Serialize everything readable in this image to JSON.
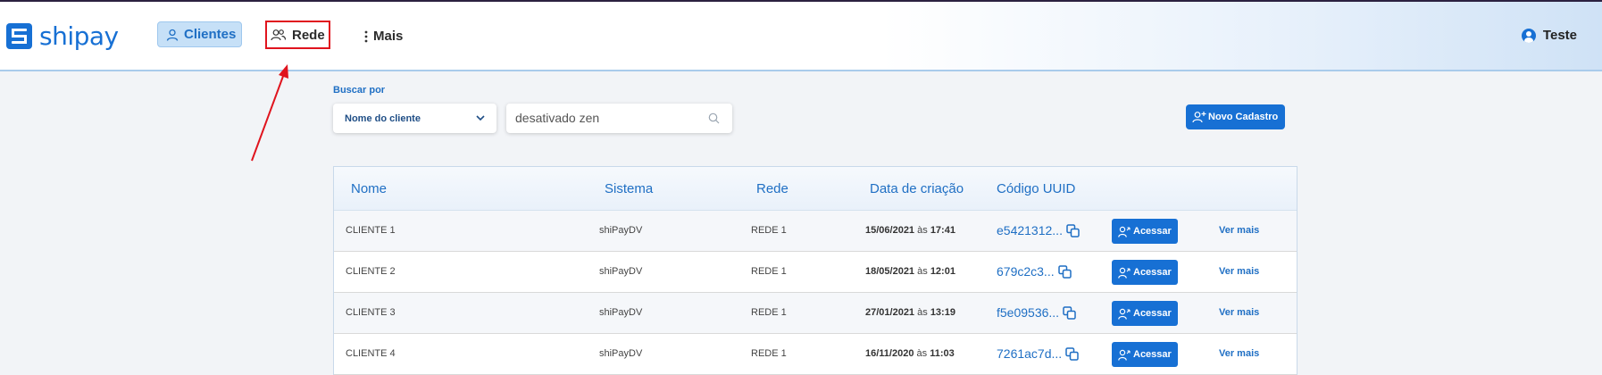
{
  "header": {
    "logo_text": "shipay",
    "nav": {
      "clientes": "Clientes",
      "rede": "Rede",
      "mais": "Mais"
    },
    "user_name": "Teste"
  },
  "search": {
    "label": "Buscar por",
    "field_selected": "Nome do cliente",
    "query": "desativado zen"
  },
  "new_button": "Novo Cadastro",
  "table": {
    "headers": {
      "nome": "Nome",
      "sistema": "Sistema",
      "rede": "Rede",
      "data": "Data de criação",
      "uuid": "Código UUID"
    },
    "rows": [
      {
        "nome": "CLIENTE 1",
        "sistema": "shiPayDV",
        "rede": "REDE 1",
        "date": "15/06/2021",
        "sep": "às",
        "time": "17:41",
        "uuid": "e5421312...",
        "acessar": "Acessar",
        "ver_mais": "Ver mais"
      },
      {
        "nome": "CLIENTE 2",
        "sistema": "shiPayDV",
        "rede": "REDE 1",
        "date": "18/05/2021",
        "sep": "às",
        "time": "12:01",
        "uuid": "679c2c3...",
        "acessar": "Acessar",
        "ver_mais": "Ver mais"
      },
      {
        "nome": "CLIENTE 3",
        "sistema": "shiPayDV",
        "rede": "REDE 1",
        "date": "27/01/2021",
        "sep": "às",
        "time": "13:19",
        "uuid": "f5e09536...",
        "acessar": "Acessar",
        "ver_mais": "Ver mais"
      },
      {
        "nome": "CLIENTE 4",
        "sistema": "shiPayDV",
        "rede": "REDE 1",
        "date": "16/11/2020",
        "sep": "às",
        "time": "11:03",
        "uuid": "7261ac7d...",
        "acessar": "Acessar",
        "ver_mais": "Ver mais"
      }
    ]
  },
  "colors": {
    "primary": "#1770d4",
    "highlight_annotation": "#e0141e"
  }
}
